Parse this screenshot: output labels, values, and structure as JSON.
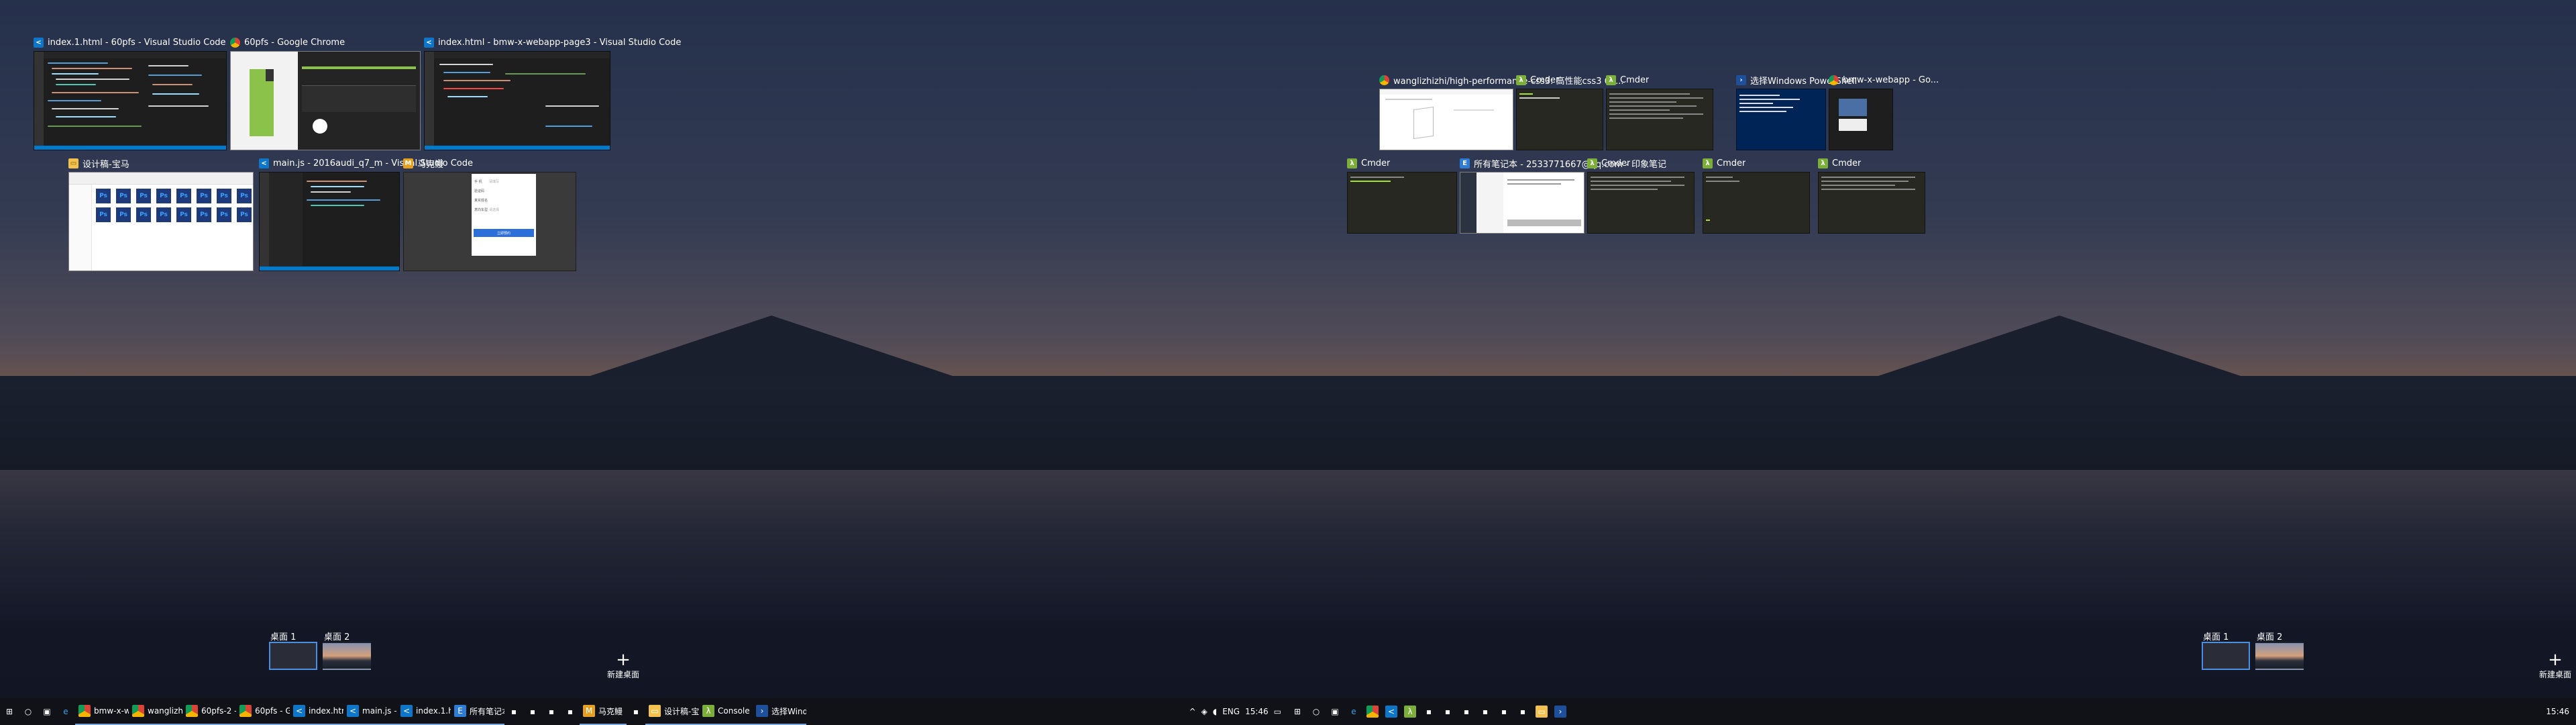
{
  "left_monitor": {
    "windows": [
      {
        "title": "index.1.html - 60pfs - Visual Studio Code",
        "app": "vscode-icon"
      },
      {
        "title": "60pfs - Google Chrome",
        "app": "chrome-icon"
      },
      {
        "title": "index.html - bmw-x-webapp-page3 - Visual Studio Code",
        "app": "vscode-icon"
      },
      {
        "title": "设计稿-宝马",
        "app": "folder-icon"
      },
      {
        "title": "main.js - 2016audi_q7_m - Visual Studio Code",
        "app": "vscode-icon"
      },
      {
        "title": "马克鳗",
        "app": "markman-icon"
      }
    ],
    "desktops": {
      "desktop1": "桌面 1",
      "desktop2": "桌面 2",
      "new_desktop": "新建桌面"
    },
    "taskbar": {
      "tasks": [
        "bmw-x-we...",
        "wanglizhi...",
        "60pfs-2 - ...",
        "60pfs - Go...",
        "index.html...",
        "main.js - 2...",
        "index.1.ht...",
        "所有笔记本...",
        "马克鳗",
        "设计稿-宝马",
        "Console E...",
        "选择Wind..."
      ],
      "language": "ENG",
      "time": "15:46"
    },
    "form_labels": [
      "手 机",
      "验证码",
      "真实姓名",
      "意向车型"
    ],
    "form_placeholders": [
      "请填写",
      "请选择"
    ],
    "form_button": "立即预约"
  },
  "right_monitor": {
    "windows": [
      {
        "title": "wanglizhizhi/high-performance-css3: 高性能css3 60...",
        "app": "chrome-icon"
      },
      {
        "title": "Cmder",
        "app": "cmder-icon"
      },
      {
        "title": "Cmder",
        "app": "cmder-icon"
      },
      {
        "title": "选择Windows PowerShell",
        "app": "powershell-icon"
      },
      {
        "title": "bmw-x-webapp - Go...",
        "app": "chrome-icon"
      },
      {
        "title": "Cmder",
        "app": "cmder-icon"
      },
      {
        "title": "所有笔记本 - 2533771667@qq.com - 印象笔记",
        "app": "evernote-icon"
      },
      {
        "title": "Cmder",
        "app": "cmder-icon"
      },
      {
        "title": "Cmder",
        "app": "cmder-icon"
      },
      {
        "title": "Cmder",
        "app": "cmder-icon"
      }
    ],
    "desktops": {
      "desktop1": "桌面 1",
      "desktop2": "桌面 2",
      "new_desktop": "新建桌面"
    },
    "taskbar": {
      "time": "15:46"
    }
  }
}
